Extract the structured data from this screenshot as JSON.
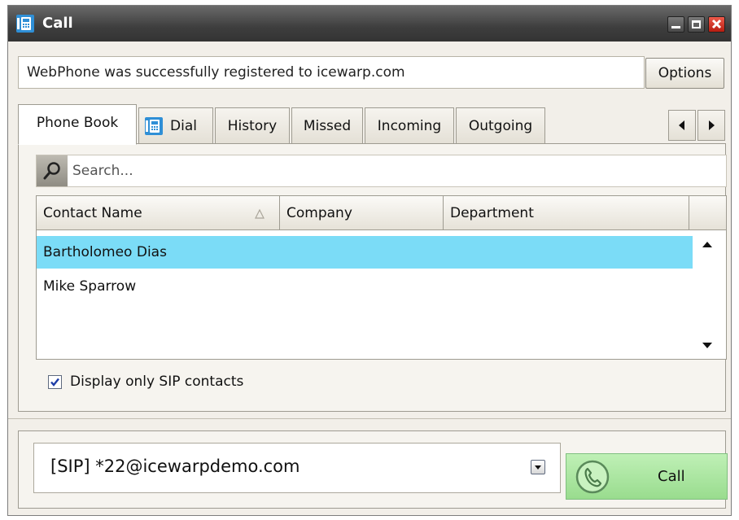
{
  "window": {
    "title": "Call",
    "status_message": "WebPhone was successfully registered to icewarp.com",
    "options_label": "Options"
  },
  "tabs": [
    {
      "label": "Phone Book",
      "active": true
    },
    {
      "label": "Dial",
      "icon": "phone-icon"
    },
    {
      "label": "History"
    },
    {
      "label": "Missed"
    },
    {
      "label": "Incoming"
    },
    {
      "label": "Outgoing"
    }
  ],
  "search": {
    "placeholder": "Search..."
  },
  "table": {
    "columns": [
      "Contact Name",
      "Company",
      "Department"
    ],
    "sort_column": "Contact Name",
    "rows": [
      {
        "name": "Bartholomeo Dias",
        "company": "",
        "department": "",
        "selected": true
      },
      {
        "name": "Mike Sparrow",
        "company": "",
        "department": ""
      }
    ]
  },
  "sip_filter": {
    "label": "Display only SIP contacts",
    "checked": true
  },
  "dial": {
    "value": "[SIP] *22@icewarpdemo.com",
    "call_label": "Call"
  },
  "colors": {
    "selected_row": "#7bdcf7",
    "call_button": "#a8e6a0",
    "titlebar": "#4a4a4a",
    "close": "#d0301f"
  }
}
